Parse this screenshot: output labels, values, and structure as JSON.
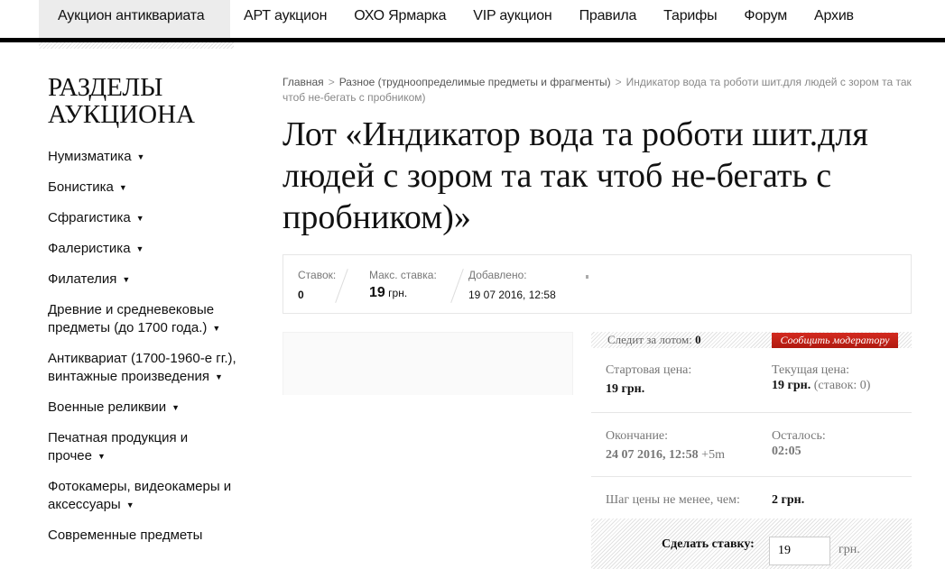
{
  "nav": {
    "items": [
      "Аукцион антиквариата",
      "АРТ аукцион",
      "ОХО Ярмарка",
      "VIP аукцион",
      "Правила",
      "Тарифы",
      "Форум",
      "Архив"
    ]
  },
  "sidebar": {
    "title": "РАЗДЕЛЫ АУКЦИОНА",
    "items": [
      "Нумизматика",
      "Бонистика",
      "Сфрагистика",
      "Фалеристика",
      "Филателия",
      "Древние и средневековые предметы (до 1700 года.)",
      "Антиквариат (1700-1960-е гг.), винтажные произведения",
      "Военные реликвии",
      "Печатная продукция и прочее",
      "Фотокамеры, видеокамеры и аксессуары",
      "Современные предметы"
    ]
  },
  "breadcrumb": {
    "home": "Главная",
    "category": "Разное (трудноопределимые предметы и фрагменты)",
    "current": "Индикатор вода та роботи шит.для людей с зором та так чтоб не-бегать с пробником)",
    "separator": ">"
  },
  "title": "Лот «Индикатор вода та роботи шит.для людей с зором та так чтоб не-бегать с пробником)»",
  "stats": {
    "bids_label": "Ставок:",
    "bids": "0",
    "max_label": "Макс. ставка:",
    "max": "19",
    "max_unit": "грн.",
    "added_label": "Добавлено:",
    "added": "19 07 2016, 12:58"
  },
  "panel": {
    "watch_label": "Следит за лотом:",
    "watch": "0",
    "report": "Сообщить модератору",
    "start_label": "Стартовая цена:",
    "start": "19 грн.",
    "current_label": "Текущая цена:",
    "current": "19 грн.",
    "current_note": "(ставок: 0)",
    "end_label": "Окончание:",
    "end": "24 07 2016, 12:58",
    "end_ext": "+5m",
    "left_label": "Осталось:",
    "left": "02:05",
    "step_label": "Шаг цены не менее, чем:",
    "step": "2 грн.",
    "bid_label": "Сделать ставку:",
    "bid_value": "19",
    "bid_unit": "грн."
  },
  "colors": {
    "accent": "#c4221a",
    "nav_active": "#ececec"
  }
}
